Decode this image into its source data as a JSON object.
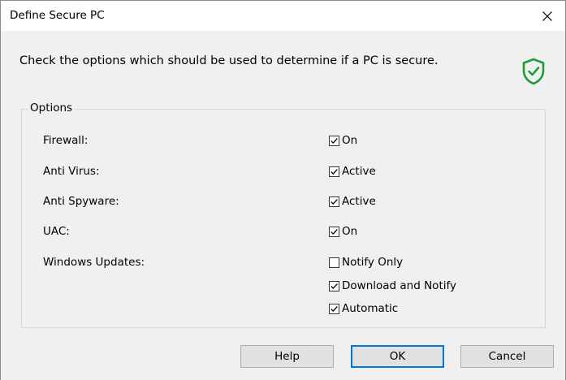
{
  "window": {
    "title": "Define Secure PC",
    "close_glyph": "✕"
  },
  "instruction": "Check the options which should be used to determine if a PC is secure.",
  "icons": {
    "shield": "shield-check-icon",
    "close": "close-icon"
  },
  "colors": {
    "accent": "#0078d7",
    "shield_green": "#1e9e3a"
  },
  "options_group": {
    "legend": "Options",
    "rows": [
      {
        "label": "Firewall:"
      },
      {
        "label": "Anti Virus:"
      },
      {
        "label": "Anti Spyware:"
      },
      {
        "label": "UAC:"
      },
      {
        "label": "Windows Updates:"
      }
    ],
    "checkboxes": {
      "firewall_on": {
        "label": "On",
        "checked": true
      },
      "antivirus_active": {
        "label": "Active",
        "checked": true
      },
      "antispyware_active": {
        "label": "Active",
        "checked": true
      },
      "uac_on": {
        "label": "On",
        "checked": true
      },
      "updates_notify_only": {
        "label": "Notify Only",
        "checked": false
      },
      "updates_download_notify": {
        "label": "Download and Notify",
        "checked": true
      },
      "updates_automatic": {
        "label": "Automatic",
        "checked": true
      }
    }
  },
  "buttons": {
    "help": "Help",
    "ok": "OK",
    "cancel": "Cancel"
  }
}
